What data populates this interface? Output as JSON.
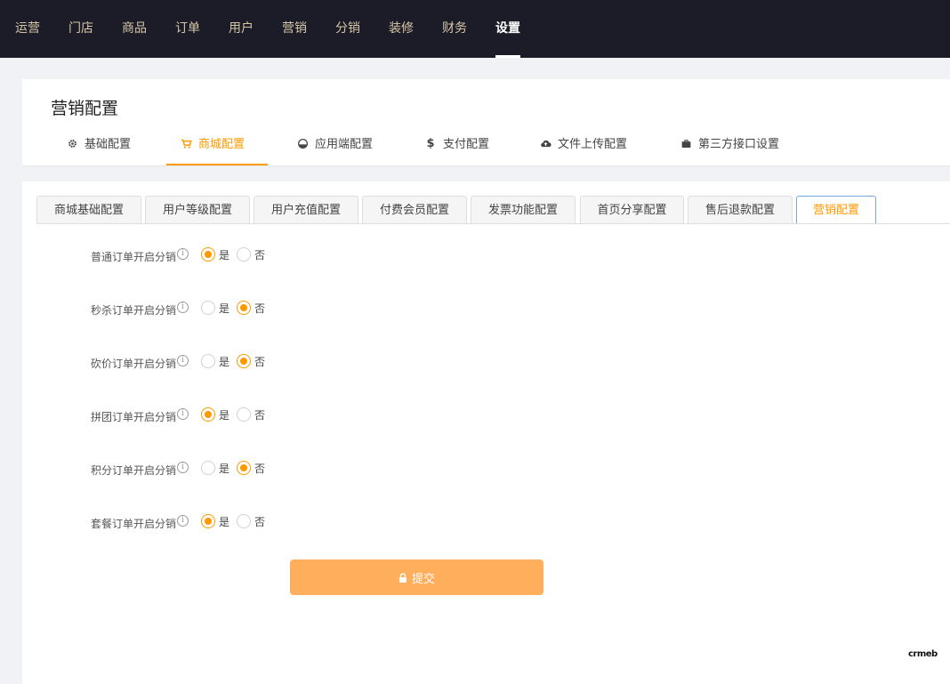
{
  "top_nav": [
    "运营",
    "门店",
    "商品",
    "订单",
    "用户",
    "营销",
    "分销",
    "装修",
    "财务",
    "设置"
  ],
  "top_nav_active": "设置",
  "page_title": "营销配置",
  "section_tabs": [
    {
      "label": "基础配置",
      "icon": "gear-icon"
    },
    {
      "label": "商城配置",
      "icon": "cart-icon",
      "active": true
    },
    {
      "label": "应用端配置",
      "icon": "pie-icon"
    },
    {
      "label": "支付配置",
      "icon": "dollar-icon"
    },
    {
      "label": "文件上传配置",
      "icon": "cloud-upload-icon"
    },
    {
      "label": "第三方接口设置",
      "icon": "briefcase-icon"
    }
  ],
  "sub_tabs": [
    {
      "label": "商城基础配置"
    },
    {
      "label": "用户等级配置"
    },
    {
      "label": "用户充值配置"
    },
    {
      "label": "付费会员配置"
    },
    {
      "label": "发票功能配置"
    },
    {
      "label": "首页分享配置"
    },
    {
      "label": "售后退款配置"
    },
    {
      "label": "营销配置",
      "active": true
    }
  ],
  "form": {
    "yes_label": "是",
    "no_label": "否",
    "info_glyph": "i",
    "rows": [
      {
        "label": "普通订单开启分销",
        "value": "是"
      },
      {
        "label": "秒杀订单开启分销",
        "value": "否"
      },
      {
        "label": "砍价订单开启分销",
        "value": "否"
      },
      {
        "label": "拼团订单开启分销",
        "value": "是"
      },
      {
        "label": "积分订单开启分销",
        "value": "否"
      },
      {
        "label": "套餐订单开启分销",
        "value": "是"
      }
    ]
  },
  "submit_label": "提交",
  "logo_text": "crmeb",
  "colors": {
    "accent": "#ff9900",
    "button": "#ffae5c",
    "topbar": "#1c1c28",
    "nav_text": "#d6c7a8",
    "active_tab_border": "#7aa6e3"
  }
}
